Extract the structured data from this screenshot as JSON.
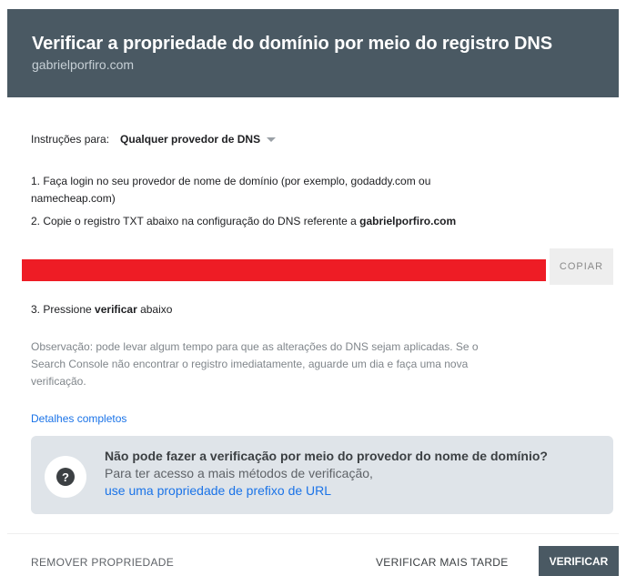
{
  "header": {
    "title": "Verificar a propriedade do domínio por meio do registro DNS",
    "domain": "gabrielporfiro.com"
  },
  "instructions": {
    "label": "Instruções para:",
    "provider": "Qualquer provedor de DNS"
  },
  "steps": {
    "step1": "1. Faça login no seu provedor de nome de domínio (por exemplo, godaddy.com ou",
    "step1_cont": "namecheap.com)",
    "step2_prefix": "2. Copie o registro TXT abaixo na configuração do DNS referente a ",
    "step2_domain": "gabrielporfiro.com",
    "step3_prefix": "3. Pressione ",
    "step3_bold": "verificar",
    "step3_suffix": " abaixo"
  },
  "txt_record": {
    "copy_label": "COPIAR",
    "redaction_color": "#ee1c25"
  },
  "note": {
    "line1": "Observação: pode levar algum tempo para que as alterações do DNS sejam aplicadas. Se o",
    "line2": "Search Console não encontrar o registro imediatamente, aguarde um dia e faça uma nova",
    "line3": "verificação."
  },
  "details_link": "Detalhes completos",
  "help_box": {
    "icon": "question-circle-icon",
    "title": "Não pode fazer a verificação por meio do provedor do nome de domínio?",
    "body": "Para ter acesso a mais métodos de verificação,",
    "link": "use uma propriedade de prefixo de URL"
  },
  "footer": {
    "remove": "REMOVER PROPRIEDADE",
    "verify_later": "VERIFICAR MAIS TARDE",
    "verify": "VERIFICAR"
  }
}
